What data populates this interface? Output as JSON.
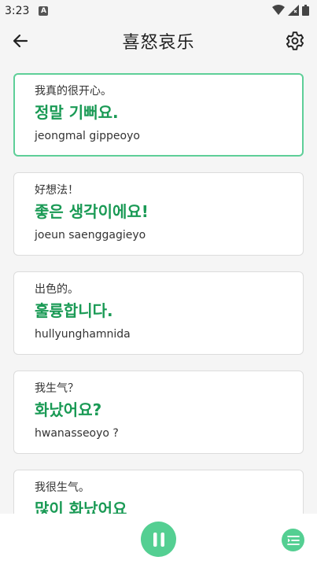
{
  "status_bar": {
    "time": "3:23",
    "notification_icon": "a-box-icon",
    "wifi_icon": "wifi-icon",
    "signal_icon": "signal-icon",
    "battery_icon": "battery-icon"
  },
  "header": {
    "title": "喜怒哀乐",
    "back_icon": "arrow-left-icon",
    "settings_icon": "gear-icon"
  },
  "phrases": [
    {
      "chinese": "我真的很开心。",
      "korean": "정말 기뻐요.",
      "romanization": "jeongmal gippeoyo",
      "selected": true
    },
    {
      "chinese": "好想法！",
      "korean": "좋은 생각이에요!",
      "romanization": "joeun saenggagieyo",
      "selected": false
    },
    {
      "chinese": "出色的。",
      "korean": "훌륭합니다.",
      "romanization": "hullyunghamnida",
      "selected": false
    },
    {
      "chinese": "我生气？",
      "korean": "화났어요?",
      "romanization": "hwanasseoyo ?",
      "selected": false
    },
    {
      "chinese": "我很生气。",
      "korean": "많이 화났어요",
      "romanization": "",
      "selected": false
    }
  ],
  "bottom_bar": {
    "play_icon": "pause-icon",
    "list_icon": "list-icon"
  },
  "colors": {
    "accent": "#54cf92",
    "korean_text": "#1a9a55",
    "selected_border": "#5ecf98"
  }
}
